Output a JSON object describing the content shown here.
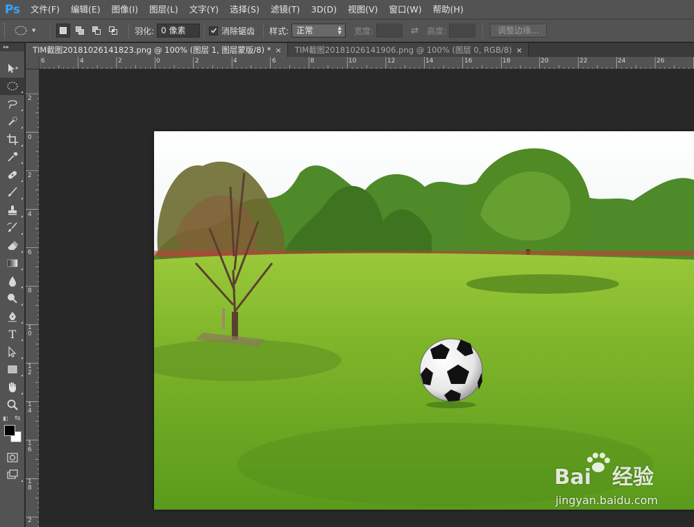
{
  "app": {
    "logo": "Ps",
    "menu": [
      "文件(F)",
      "编辑(E)",
      "图像(I)",
      "图层(L)",
      "文字(Y)",
      "选择(S)",
      "滤镜(T)",
      "3D(D)",
      "视图(V)",
      "窗口(W)",
      "帮助(H)"
    ]
  },
  "options": {
    "feather_label": "羽化:",
    "feather_value": "0 像素",
    "antialias_label": "消除锯齿",
    "antialias_checked": true,
    "style_label": "样式:",
    "style_value": "正常",
    "width_label": "宽度:",
    "height_label": "高度:",
    "refine_edge_label": "调整边缘..."
  },
  "toolbar": {
    "header": "▸▸",
    "active_tool": "elliptical-marquee",
    "foreground_color": "#000000",
    "background_color": "#ffffff"
  },
  "tabs": [
    {
      "label": "TIM截图20181026141823.png @ 100% (图层 1, 图层蒙版/8) *",
      "active": true
    },
    {
      "label": "TIM截图20181026141906.png @ 100% (图层 0, RGB/8)",
      "active": false
    }
  ],
  "rulers": {
    "top_labels": [
      "6",
      "4",
      "2",
      "0",
      "2",
      "4",
      "6",
      "8",
      "10",
      "12",
      "14",
      "16",
      "18",
      "20",
      "22",
      "24",
      "26"
    ],
    "left_labels": [
      "2",
      "0",
      "2",
      "4",
      "6",
      "8",
      "10",
      "12",
      "14",
      "16",
      "18",
      "2"
    ]
  },
  "watermark": {
    "logo_text": "Bai",
    "logo_cn": "经验",
    "url": "jingyan.baidu.com"
  }
}
